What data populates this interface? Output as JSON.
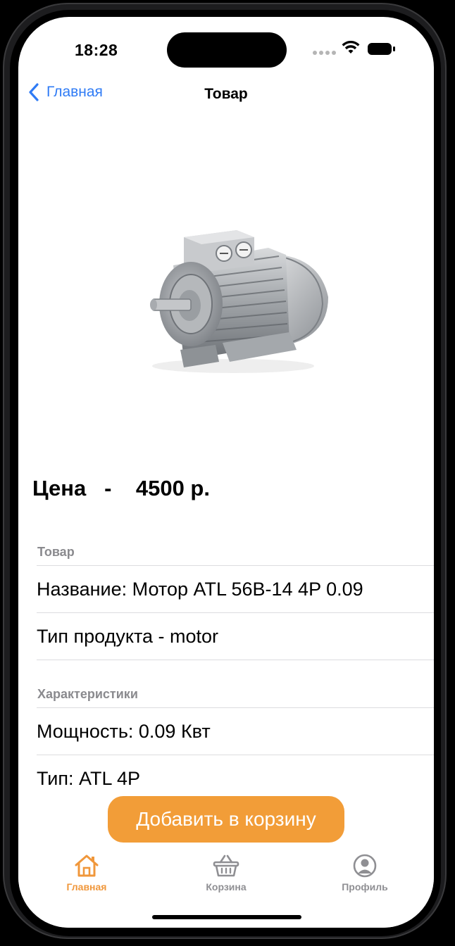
{
  "status_bar": {
    "time": "18:28"
  },
  "nav": {
    "back_label": "Главная",
    "title": "Товар"
  },
  "product_image": {
    "description_icon": "electric-motor-image"
  },
  "price": {
    "label": "Цена",
    "separator": "-",
    "value": "4500 р."
  },
  "sections": [
    {
      "header": "Товар",
      "rows": [
        "Название: Мотор ATL 56B-14 4P 0.09",
        "Тип продукта - motor"
      ]
    },
    {
      "header": "Характеристики",
      "rows": [
        "Мощность: 0.09 Квт",
        "Тип: ATL 4P"
      ]
    }
  ],
  "add_to_cart": {
    "label": "Добавить в корзину"
  },
  "tabbar": {
    "items": [
      {
        "label": "Главная",
        "icon": "house-icon",
        "active": true
      },
      {
        "label": "Корзина",
        "icon": "basket-icon",
        "active": false
      },
      {
        "label": "Профиль",
        "icon": "person-circle-icon",
        "active": false
      }
    ]
  },
  "colors": {
    "accent": "#f29d38",
    "link": "#2f7bf5",
    "tab_active": "#f0973b",
    "tab_inactive": "#8f8f93"
  }
}
